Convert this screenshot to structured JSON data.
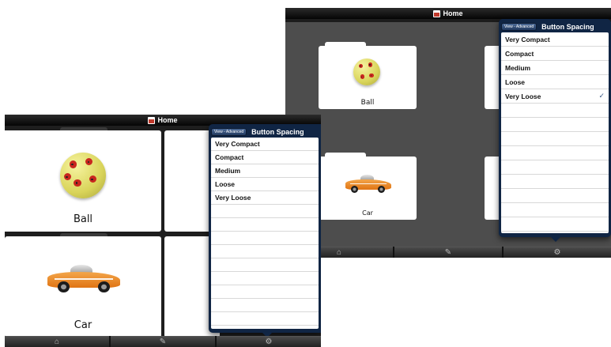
{
  "title": "Home",
  "popover": {
    "back_label": "View - Advanced",
    "title": "Button Spacing",
    "options": [
      "Very Compact",
      "Compact",
      "Medium",
      "Loose",
      "Very Loose"
    ],
    "selected": "Very Loose",
    "checkmark": "✓"
  },
  "folders": [
    {
      "label": "Ball",
      "image": "ladybug-ball-image"
    },
    {
      "label": "Car",
      "image": "orange-race-car-image"
    }
  ],
  "toolbar": {
    "items": [
      {
        "icon": "house-icon",
        "glyph": "⌂"
      },
      {
        "icon": "pencil-icon",
        "glyph": "✎"
      },
      {
        "icon": "gear-icon",
        "glyph": "⚙"
      }
    ]
  },
  "colors": {
    "background_dark": "#4a4a4a",
    "popover_navy": "#102544",
    "car_orange": "#e07414",
    "ball_yellow": "#d9d45a"
  }
}
